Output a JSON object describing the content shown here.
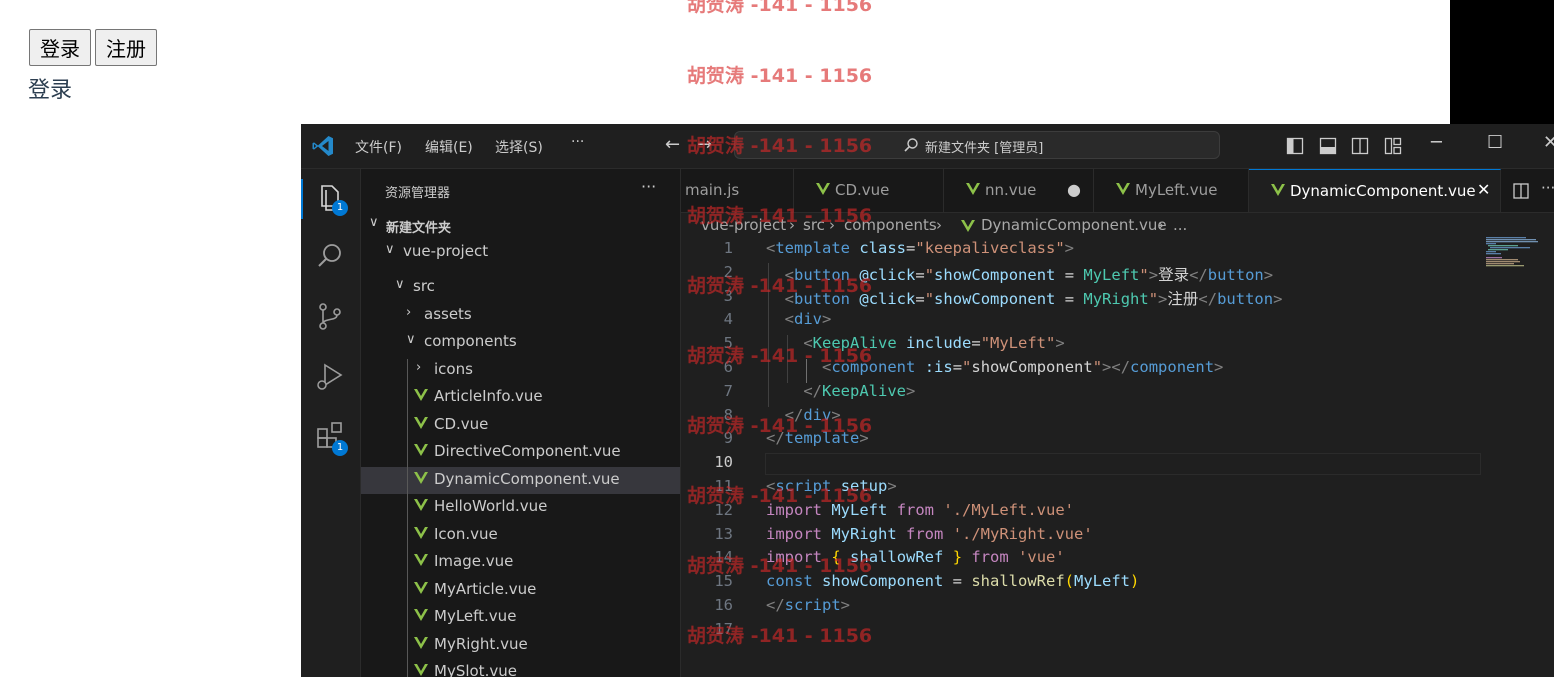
{
  "page": {
    "buttons": [
      "登录",
      "注册"
    ],
    "current_component_text": "登录"
  },
  "watermark": "胡贺涛 -141 - 1156",
  "vscode": {
    "menu": [
      "文件(F)",
      "编辑(E)",
      "选择(S)",
      "···"
    ],
    "search_text": "新建文件夹 [管理员]",
    "explorer": {
      "title": "资源管理器",
      "more": "···",
      "folder_root": "新建文件夹",
      "project": "vue-project",
      "items": [
        {
          "label": "src",
          "chevron": "v"
        },
        {
          "label": "assets",
          "chevron": ">"
        },
        {
          "label": "components",
          "chevron": "v"
        },
        {
          "label": "icons",
          "chevron": ">"
        },
        {
          "label": "ArticleInfo.vue"
        },
        {
          "label": "CD.vue"
        },
        {
          "label": "DirectiveComponent.vue"
        },
        {
          "label": "DynamicComponent.vue",
          "active": true
        },
        {
          "label": "HelloWorld.vue"
        },
        {
          "label": "Icon.vue"
        },
        {
          "label": "Image.vue"
        },
        {
          "label": "MyArticle.vue"
        },
        {
          "label": "MyLeft.vue"
        },
        {
          "label": "MyRight.vue"
        },
        {
          "label": "MySlot.vue"
        }
      ]
    },
    "activity_badges": [
      "1",
      "1"
    ],
    "tabs": [
      {
        "label": "main.js"
      },
      {
        "label": "CD.vue"
      },
      {
        "label": "nn.vue",
        "modified": true
      },
      {
        "label": "MyLeft.vue"
      },
      {
        "label": "DynamicComponent.vue",
        "active": true
      }
    ],
    "breadcrumb": [
      "vue-project",
      "src",
      "components",
      "DynamicComponent.vue",
      "..."
    ],
    "current_line": 10,
    "code": [
      [
        [
          "t-br",
          "<"
        ],
        [
          "t-tag",
          "template"
        ],
        [
          "t-plain",
          " "
        ],
        [
          "t-attr",
          "class"
        ],
        [
          "t-plain",
          "="
        ],
        [
          "t-str",
          "\"keepaliveclass\""
        ],
        [
          "t-br",
          ">"
        ]
      ],
      [
        [
          "t-plain",
          "  "
        ],
        [
          "t-br",
          "<"
        ],
        [
          "t-tag",
          "button"
        ],
        [
          "t-plain",
          " "
        ],
        [
          "t-attr",
          "@click"
        ],
        [
          "t-plain",
          "="
        ],
        [
          "t-str",
          "\""
        ],
        [
          "t-var",
          "showComponent"
        ],
        [
          "t-plain",
          " = "
        ],
        [
          "t-comp",
          "MyLeft"
        ],
        [
          "t-str",
          "\""
        ],
        [
          "t-br",
          ">"
        ],
        [
          "t-plain",
          "登录"
        ],
        [
          "t-br",
          "</"
        ],
        [
          "t-tag",
          "button"
        ],
        [
          "t-br",
          ">"
        ]
      ],
      [
        [
          "t-plain",
          "  "
        ],
        [
          "t-br",
          "<"
        ],
        [
          "t-tag",
          "button"
        ],
        [
          "t-plain",
          " "
        ],
        [
          "t-attr",
          "@click"
        ],
        [
          "t-plain",
          "="
        ],
        [
          "t-str",
          "\""
        ],
        [
          "t-var",
          "showComponent"
        ],
        [
          "t-plain",
          " = "
        ],
        [
          "t-comp",
          "MyRight"
        ],
        [
          "t-str",
          "\""
        ],
        [
          "t-br",
          ">"
        ],
        [
          "t-plain",
          "注册"
        ],
        [
          "t-br",
          "</"
        ],
        [
          "t-tag",
          "button"
        ],
        [
          "t-br",
          ">"
        ]
      ],
      [
        [
          "t-plain",
          "  "
        ],
        [
          "t-br",
          "<"
        ],
        [
          "t-tag",
          "div"
        ],
        [
          "t-br",
          ">"
        ]
      ],
      [
        [
          "t-plain",
          "    "
        ],
        [
          "t-br",
          "<"
        ],
        [
          "t-comp",
          "KeepAlive"
        ],
        [
          "t-plain",
          " "
        ],
        [
          "t-attr",
          "include"
        ],
        [
          "t-plain",
          "="
        ],
        [
          "t-str",
          "\"MyLeft\""
        ],
        [
          "t-br",
          ">"
        ]
      ],
      [
        [
          "t-plain",
          "      "
        ],
        [
          "t-br",
          "<"
        ],
        [
          "t-tag",
          "component"
        ],
        [
          "t-plain",
          " "
        ],
        [
          "t-attr",
          ":is"
        ],
        [
          "t-plain",
          "="
        ],
        [
          "t-str",
          "\""
        ],
        [
          "t-plain",
          "showComponent"
        ],
        [
          "t-str",
          "\""
        ],
        [
          "t-br",
          "></"
        ],
        [
          "t-tag",
          "component"
        ],
        [
          "t-br",
          ">"
        ]
      ],
      [
        [
          "t-plain",
          "    "
        ],
        [
          "t-br",
          "</"
        ],
        [
          "t-comp",
          "KeepAlive"
        ],
        [
          "t-br",
          ">"
        ]
      ],
      [
        [
          "t-plain",
          "  "
        ],
        [
          "t-br",
          "</"
        ],
        [
          "t-tag",
          "div"
        ],
        [
          "t-br",
          ">"
        ]
      ],
      [
        [
          "t-br",
          "</"
        ],
        [
          "t-tag",
          "template"
        ],
        [
          "t-br",
          ">"
        ]
      ],
      [],
      [
        [
          "t-br",
          "<"
        ],
        [
          "t-tag",
          "script"
        ],
        [
          "t-plain",
          " "
        ],
        [
          "t-attr",
          "setup"
        ],
        [
          "t-br",
          ">"
        ]
      ],
      [
        [
          "t-kw",
          "import"
        ],
        [
          "t-plain",
          " "
        ],
        [
          "t-var",
          "MyLeft"
        ],
        [
          "t-plain",
          " "
        ],
        [
          "t-kw",
          "from"
        ],
        [
          "t-plain",
          " "
        ],
        [
          "t-str",
          "'./MyLeft.vue'"
        ]
      ],
      [
        [
          "t-kw",
          "import"
        ],
        [
          "t-plain",
          " "
        ],
        [
          "t-var",
          "MyRight"
        ],
        [
          "t-plain",
          " "
        ],
        [
          "t-kw",
          "from"
        ],
        [
          "t-plain",
          " "
        ],
        [
          "t-str",
          "'./MyRight.vue'"
        ]
      ],
      [
        [
          "t-kw",
          "import"
        ],
        [
          "t-plain",
          " "
        ],
        [
          "t-braces",
          "{"
        ],
        [
          "t-plain",
          " "
        ],
        [
          "t-var",
          "shallowRef"
        ],
        [
          "t-plain",
          " "
        ],
        [
          "t-braces",
          "}"
        ],
        [
          "t-plain",
          " "
        ],
        [
          "t-kw",
          "from"
        ],
        [
          "t-plain",
          " "
        ],
        [
          "t-str",
          "'vue'"
        ]
      ],
      [
        [
          "t-const",
          "const"
        ],
        [
          "t-plain",
          " "
        ],
        [
          "t-var",
          "showComponent"
        ],
        [
          "t-plain",
          " = "
        ],
        [
          "t-fn",
          "shallowRef"
        ],
        [
          "t-braces",
          "("
        ],
        [
          "t-var",
          "MyLeft"
        ],
        [
          "t-braces",
          ")"
        ]
      ],
      [
        [
          "t-br",
          "</"
        ],
        [
          "t-tag",
          "script"
        ],
        [
          "t-br",
          ">"
        ]
      ],
      []
    ]
  }
}
